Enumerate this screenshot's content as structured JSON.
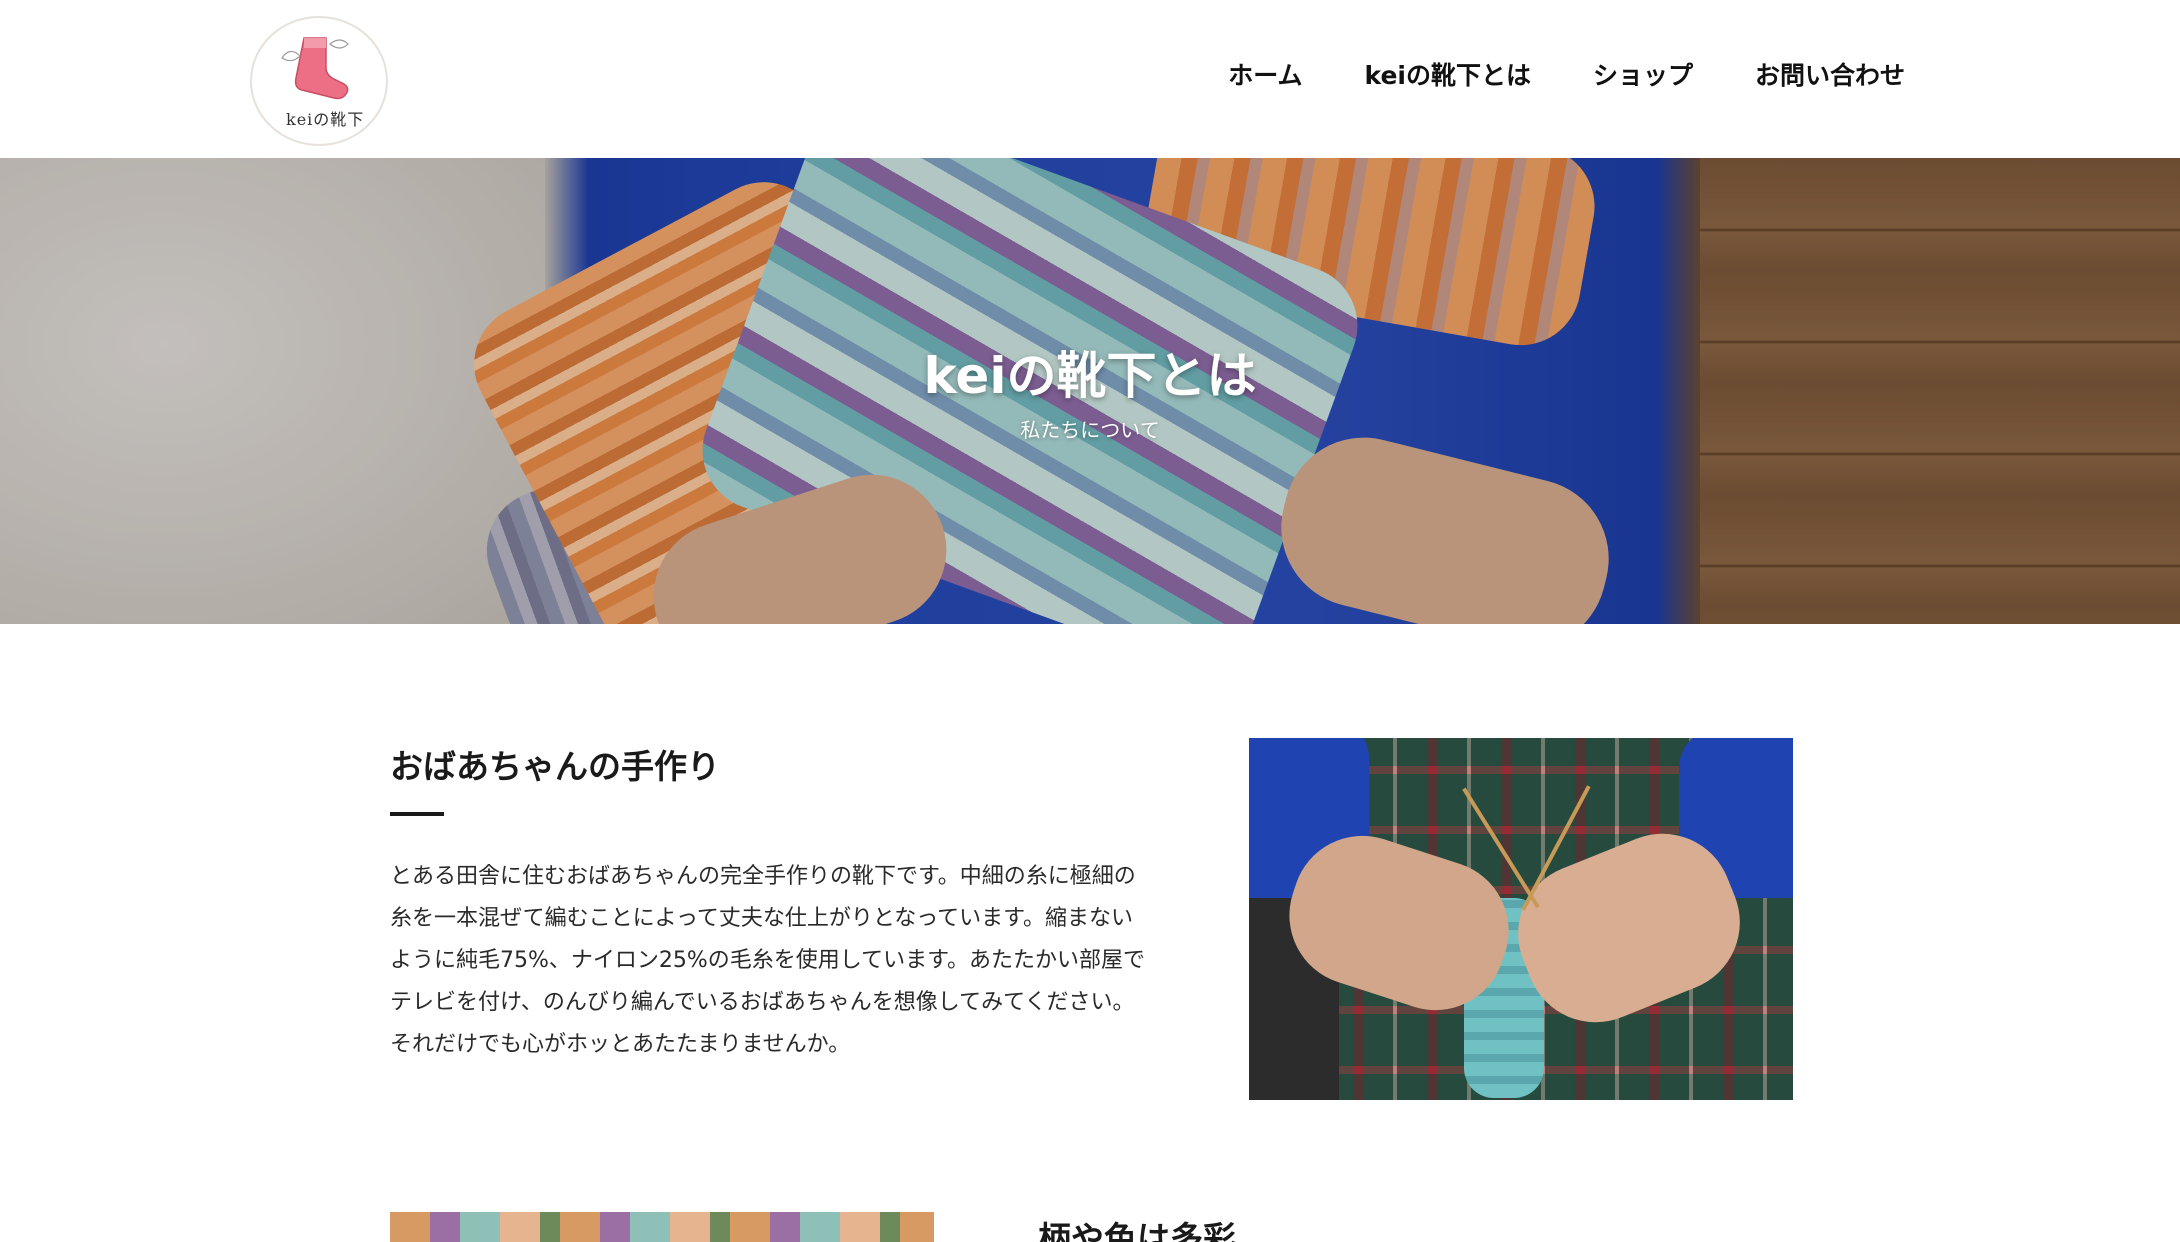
{
  "header": {
    "logo_text": "keiの靴下",
    "nav": [
      "ホーム",
      "keiの靴下とは",
      "ショップ",
      "お問い合わせ"
    ]
  },
  "hero": {
    "title": "keiの靴下とは",
    "subtitle": "私たちについて"
  },
  "section1": {
    "title": "おばあちゃんの手作り",
    "body": "とある田舎に住むおばあちゃんの完全手作りの靴下です。中細の糸に極細の糸を一本混ぜて編むことによって丈夫な仕上がりとなっています。縮まないように純毛75%、ナイロン25%の毛糸を使用しています。あたたかい部屋でテレビを付け、のんびり編んでいるおばあちゃんを想像してみてください。それだけでも心がホッとあたたまりませんか。"
  },
  "section2": {
    "title": "柄や色は多彩"
  },
  "colors": {
    "hero_blue": "#2548b3",
    "text": "#222222",
    "accent_sock_pink": "#e8647a"
  }
}
